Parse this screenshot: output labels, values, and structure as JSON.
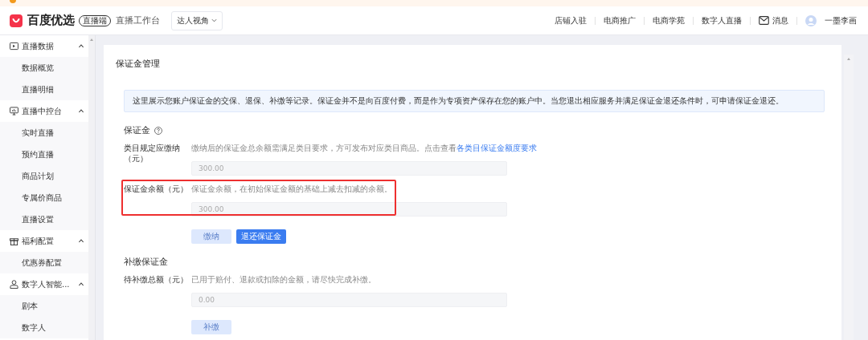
{
  "header": {
    "logo": "百度优选",
    "badge": "直播端",
    "subtitle": "直播工作台",
    "view_select": "达人视角",
    "nav": [
      "店铺入驻",
      "电商推广",
      "电商学苑",
      "数字人直播"
    ],
    "messages": "消息",
    "user": "一墨李画"
  },
  "sidebar": {
    "groups": [
      {
        "label": "直播数据",
        "expanded": true,
        "children": [
          {
            "label": "数据概览",
            "selected": false
          },
          {
            "label": "直播明细",
            "selected": false
          }
        ]
      },
      {
        "label": "直播中控台",
        "expanded": true,
        "children": [
          {
            "label": "实时直播",
            "selected": false
          },
          {
            "label": "预约直播",
            "selected": false
          },
          {
            "label": "商品计划",
            "selected": false
          },
          {
            "label": "专属价商品",
            "selected": false
          },
          {
            "label": "直播设置",
            "selected": false
          }
        ]
      },
      {
        "label": "福利配置",
        "expanded": true,
        "children": [
          {
            "label": "优惠券配置",
            "selected": false
          }
        ]
      },
      {
        "label": "数字人智能...",
        "expanded": true,
        "children": [
          {
            "label": "剧本",
            "selected": false
          },
          {
            "label": "数字人",
            "selected": false
          }
        ]
      }
    ]
  },
  "page_title": "保证金管理",
  "notice": "这里展示您账户保证金的交保、退保、补缴等记录。保证金并不是向百度付费，而是作为专项资产保存在您的账户中。当您退出相应服务并满足保证金退还条件时，可申请保证金退还。",
  "sections": [
    {
      "title": "保证金",
      "help": true,
      "fields": [
        {
          "label": "类目规定应缴纳（元）",
          "hint": "缴纳后的保证金总余额需满足类目要求，方可发布对应类目商品。点击查看",
          "link": "各类目保证金额度要求",
          "value": "300.00",
          "disabled": true,
          "highlighted": false
        },
        {
          "label": "保证金余额（元）",
          "hint": "保证金余额，在初始保证金额的基础上减去扣减的余额。",
          "value": "300.00",
          "disabled": true,
          "highlighted": true
        }
      ],
      "buttons": [
        {
          "label": "缴纳",
          "disabled": true
        },
        {
          "label": "退还保证金",
          "disabled": false
        }
      ]
    },
    {
      "title": "补缴保证金",
      "help": false,
      "fields": [
        {
          "label": "待补缴总额（元）",
          "hint": "已用于赔付、退款或扣除的金额，请尽快完成补缴。",
          "value": "0.00",
          "disabled": true,
          "highlighted": false
        }
      ],
      "buttons": [
        {
          "label": "补缴",
          "disabled": true
        }
      ]
    }
  ]
}
